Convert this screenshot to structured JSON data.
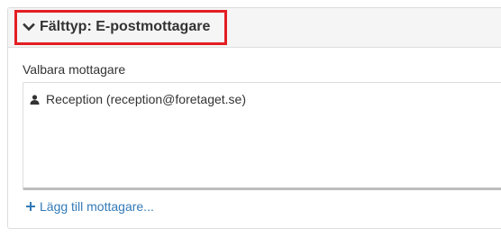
{
  "panel": {
    "heading": {
      "title": "Fälttyp: E-postmottagare",
      "icon": "chevron-down-icon"
    },
    "field_label": "Valbara mottagare",
    "recipients": [
      {
        "label": "Reception (reception@foretaget.se)",
        "icon": "user-icon"
      }
    ],
    "add_link": {
      "label": "Lägg till mottagare...",
      "icon": "plus-icon"
    }
  },
  "colors": {
    "highlight": "#e31e24",
    "link": "#337ab7",
    "heading_bg": "#f5f5f5",
    "border": "#dddddd"
  }
}
